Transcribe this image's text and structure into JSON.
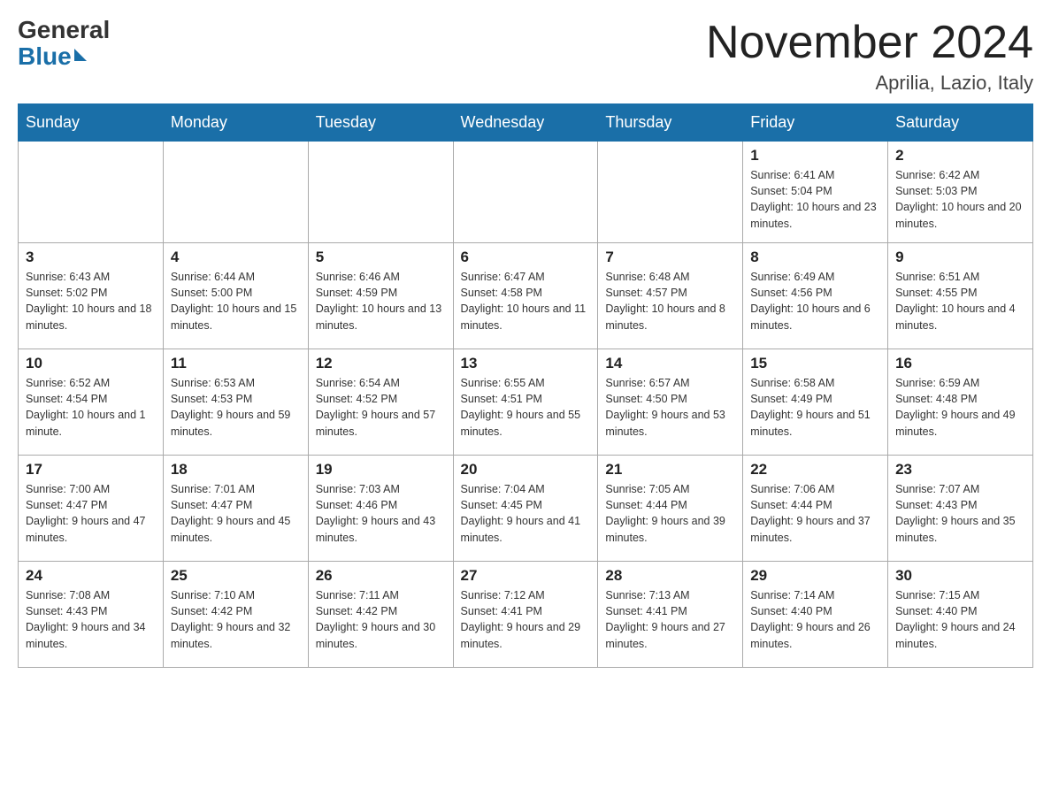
{
  "header": {
    "logo_general": "General",
    "logo_blue": "Blue",
    "month_title": "November 2024",
    "location": "Aprilia, Lazio, Italy"
  },
  "days_of_week": [
    "Sunday",
    "Monday",
    "Tuesday",
    "Wednesday",
    "Thursday",
    "Friday",
    "Saturday"
  ],
  "weeks": [
    [
      {
        "day": "",
        "info": ""
      },
      {
        "day": "",
        "info": ""
      },
      {
        "day": "",
        "info": ""
      },
      {
        "day": "",
        "info": ""
      },
      {
        "day": "",
        "info": ""
      },
      {
        "day": "1",
        "info": "Sunrise: 6:41 AM\nSunset: 5:04 PM\nDaylight: 10 hours and 23 minutes."
      },
      {
        "day": "2",
        "info": "Sunrise: 6:42 AM\nSunset: 5:03 PM\nDaylight: 10 hours and 20 minutes."
      }
    ],
    [
      {
        "day": "3",
        "info": "Sunrise: 6:43 AM\nSunset: 5:02 PM\nDaylight: 10 hours and 18 minutes."
      },
      {
        "day": "4",
        "info": "Sunrise: 6:44 AM\nSunset: 5:00 PM\nDaylight: 10 hours and 15 minutes."
      },
      {
        "day": "5",
        "info": "Sunrise: 6:46 AM\nSunset: 4:59 PM\nDaylight: 10 hours and 13 minutes."
      },
      {
        "day": "6",
        "info": "Sunrise: 6:47 AM\nSunset: 4:58 PM\nDaylight: 10 hours and 11 minutes."
      },
      {
        "day": "7",
        "info": "Sunrise: 6:48 AM\nSunset: 4:57 PM\nDaylight: 10 hours and 8 minutes."
      },
      {
        "day": "8",
        "info": "Sunrise: 6:49 AM\nSunset: 4:56 PM\nDaylight: 10 hours and 6 minutes."
      },
      {
        "day": "9",
        "info": "Sunrise: 6:51 AM\nSunset: 4:55 PM\nDaylight: 10 hours and 4 minutes."
      }
    ],
    [
      {
        "day": "10",
        "info": "Sunrise: 6:52 AM\nSunset: 4:54 PM\nDaylight: 10 hours and 1 minute."
      },
      {
        "day": "11",
        "info": "Sunrise: 6:53 AM\nSunset: 4:53 PM\nDaylight: 9 hours and 59 minutes."
      },
      {
        "day": "12",
        "info": "Sunrise: 6:54 AM\nSunset: 4:52 PM\nDaylight: 9 hours and 57 minutes."
      },
      {
        "day": "13",
        "info": "Sunrise: 6:55 AM\nSunset: 4:51 PM\nDaylight: 9 hours and 55 minutes."
      },
      {
        "day": "14",
        "info": "Sunrise: 6:57 AM\nSunset: 4:50 PM\nDaylight: 9 hours and 53 minutes."
      },
      {
        "day": "15",
        "info": "Sunrise: 6:58 AM\nSunset: 4:49 PM\nDaylight: 9 hours and 51 minutes."
      },
      {
        "day": "16",
        "info": "Sunrise: 6:59 AM\nSunset: 4:48 PM\nDaylight: 9 hours and 49 minutes."
      }
    ],
    [
      {
        "day": "17",
        "info": "Sunrise: 7:00 AM\nSunset: 4:47 PM\nDaylight: 9 hours and 47 minutes."
      },
      {
        "day": "18",
        "info": "Sunrise: 7:01 AM\nSunset: 4:47 PM\nDaylight: 9 hours and 45 minutes."
      },
      {
        "day": "19",
        "info": "Sunrise: 7:03 AM\nSunset: 4:46 PM\nDaylight: 9 hours and 43 minutes."
      },
      {
        "day": "20",
        "info": "Sunrise: 7:04 AM\nSunset: 4:45 PM\nDaylight: 9 hours and 41 minutes."
      },
      {
        "day": "21",
        "info": "Sunrise: 7:05 AM\nSunset: 4:44 PM\nDaylight: 9 hours and 39 minutes."
      },
      {
        "day": "22",
        "info": "Sunrise: 7:06 AM\nSunset: 4:44 PM\nDaylight: 9 hours and 37 minutes."
      },
      {
        "day": "23",
        "info": "Sunrise: 7:07 AM\nSunset: 4:43 PM\nDaylight: 9 hours and 35 minutes."
      }
    ],
    [
      {
        "day": "24",
        "info": "Sunrise: 7:08 AM\nSunset: 4:43 PM\nDaylight: 9 hours and 34 minutes."
      },
      {
        "day": "25",
        "info": "Sunrise: 7:10 AM\nSunset: 4:42 PM\nDaylight: 9 hours and 32 minutes."
      },
      {
        "day": "26",
        "info": "Sunrise: 7:11 AM\nSunset: 4:42 PM\nDaylight: 9 hours and 30 minutes."
      },
      {
        "day": "27",
        "info": "Sunrise: 7:12 AM\nSunset: 4:41 PM\nDaylight: 9 hours and 29 minutes."
      },
      {
        "day": "28",
        "info": "Sunrise: 7:13 AM\nSunset: 4:41 PM\nDaylight: 9 hours and 27 minutes."
      },
      {
        "day": "29",
        "info": "Sunrise: 7:14 AM\nSunset: 4:40 PM\nDaylight: 9 hours and 26 minutes."
      },
      {
        "day": "30",
        "info": "Sunrise: 7:15 AM\nSunset: 4:40 PM\nDaylight: 9 hours and 24 minutes."
      }
    ]
  ]
}
